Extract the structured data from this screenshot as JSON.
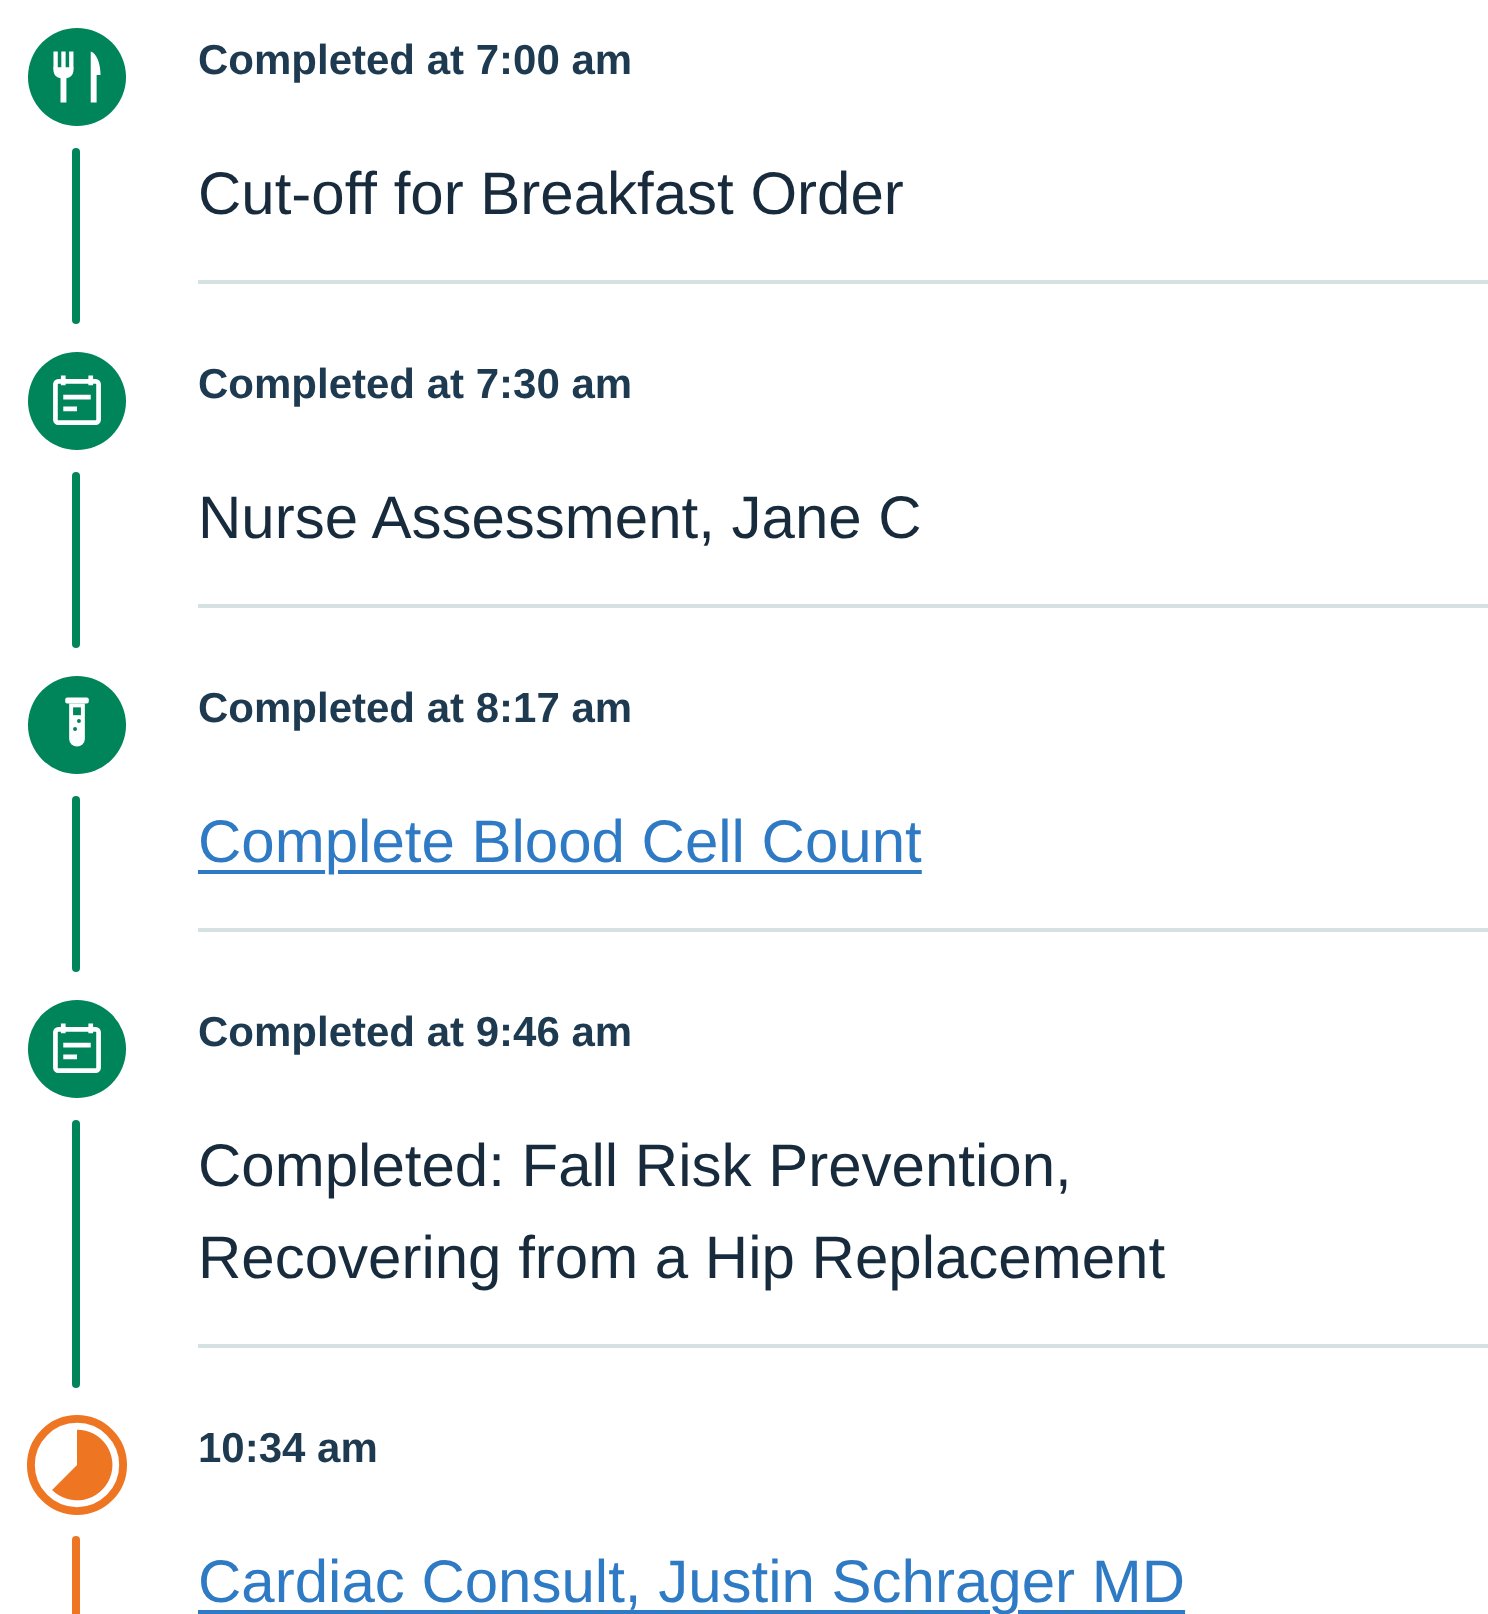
{
  "timeline": [
    {
      "completed": true,
      "kind": "meal",
      "time": "Completed at 7:00 am",
      "title": "Cut-off for Breakfast Order",
      "link": false
    },
    {
      "completed": true,
      "kind": "task",
      "time": "Completed at 7:30 am",
      "title": "Nurse Assessment, Jane C",
      "link": false
    },
    {
      "completed": true,
      "kind": "lab",
      "time": "Completed at 8:17 am",
      "title": "Complete Blood Cell Count",
      "link": true
    },
    {
      "completed": true,
      "kind": "task",
      "time": "Completed at 9:46 am",
      "title": "Completed: Fall Risk Prevention, Recovering from a Hip Replacement",
      "link": false
    },
    {
      "completed": false,
      "kind": "pending",
      "time": "10:34 am",
      "title": "Cardiac Consult, Justin Schrager MD",
      "link": true
    }
  ]
}
